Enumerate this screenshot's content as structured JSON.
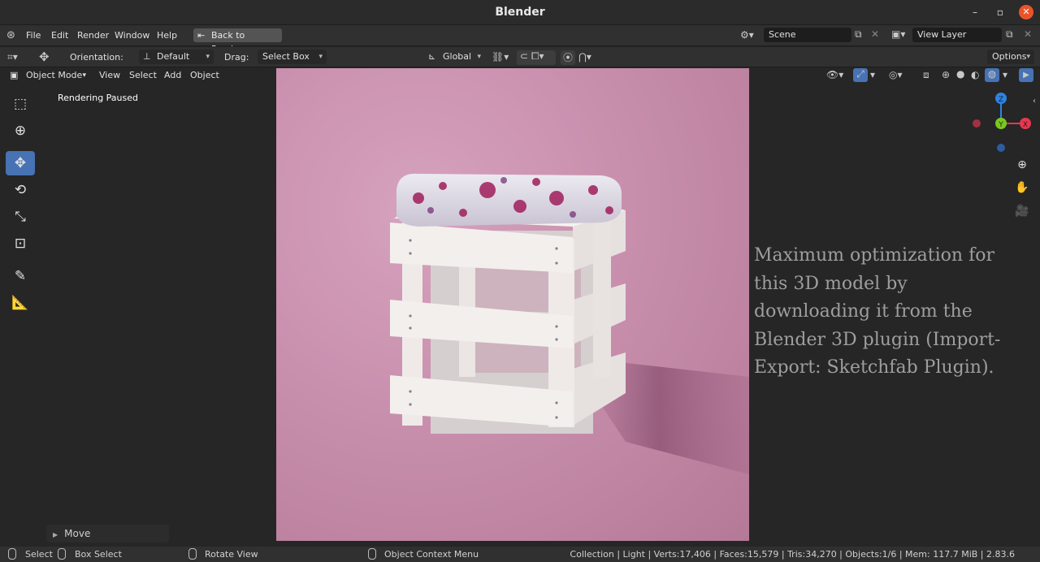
{
  "window": {
    "title": "Blender",
    "minimize": "–",
    "maximize": "▫",
    "close": "✕"
  },
  "menubar": {
    "items": [
      "File",
      "Edit",
      "Render",
      "Window",
      "Help"
    ],
    "back_button": "Back to Previous",
    "scene_field": "Scene",
    "view_layer_field": "View Layer"
  },
  "tool_header": {
    "orientation_label": "Orientation:",
    "orientation_value": "Default",
    "drag_label": "Drag:",
    "drag_value": "Select Box",
    "transform_orientation": "Global",
    "options_label": "Options"
  },
  "viewport_header": {
    "mode": "Object Mode",
    "menu_items": [
      "View",
      "Select",
      "Add",
      "Object"
    ]
  },
  "viewport": {
    "render_status": "Rendering Paused",
    "overlay_text": [
      "Maximum optimization for",
      "this 3D model by",
      "downloading it from the",
      "Blender 3D plugin (Import-",
      "Export: Sketchfab Plugin)."
    ],
    "gizmo_labels": {
      "z": "Z",
      "y": "Y",
      "x": "X"
    }
  },
  "last_operation_panel": {
    "label": "Move"
  },
  "statusbar": {
    "select": "Select",
    "box_select": "Box Select",
    "rotate_view": "Rotate View",
    "context_menu": "Object Context Menu",
    "stats": "Collection | Light | Verts:17,406 | Faces:15,579 | Tris:34,270 | Objects:1/6 | Mem: 117.7 MiB | 2.83.6"
  },
  "colors": {
    "active_tool": "#4772b3",
    "render_background": "#c88fad",
    "gizmo_x": "#e8374f",
    "gizmo_y": "#7ac722",
    "gizmo_z": "#2f83e3"
  }
}
